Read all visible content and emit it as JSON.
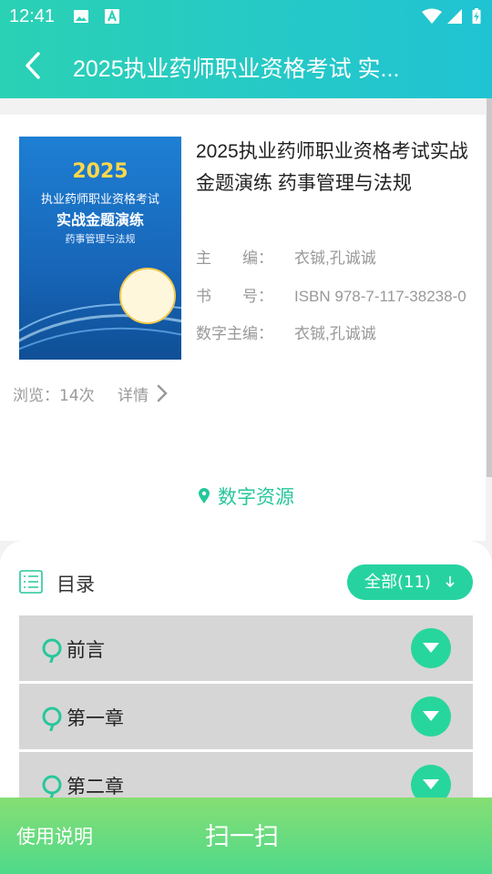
{
  "status": {
    "time": "12:41"
  },
  "appbar": {
    "title": "2025执业药师职业资格考试 实..."
  },
  "book": {
    "title": "2025执业药师职业资格考试实战金题演练 药事管理与法规",
    "cover": {
      "year": "2025",
      "line1": "执业药师职业资格考试",
      "line2": "实战金题演练",
      "line3": "药事管理与法规"
    },
    "meta": [
      {
        "label": "主　　编：",
        "value": "衣铖,孔诚诚"
      },
      {
        "label": "书　　号：",
        "value": "ISBN 978-7-117-38238-0"
      },
      {
        "label": "数字主编：",
        "value": "衣铖,孔诚诚"
      }
    ],
    "views": "浏览：14次",
    "details_label": "详情"
  },
  "digital_resources_label": "数字资源",
  "catalog": {
    "title": "目录",
    "filter_label": "全部(11)",
    "chapters": [
      "前言",
      "第一章",
      "第二章"
    ]
  },
  "bottom": {
    "usage_label": "使用说明",
    "scan_label": "扫一扫"
  },
  "colors": {
    "accent": "#26d3a0",
    "header": "#26c9c6",
    "bottom": "#5fda84"
  }
}
